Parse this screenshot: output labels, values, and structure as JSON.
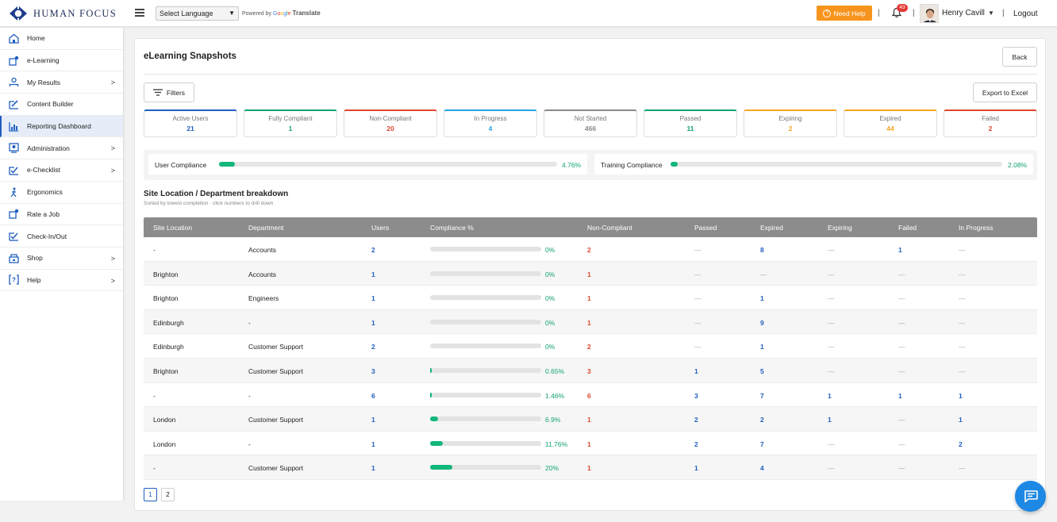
{
  "header": {
    "brand": "HUMAN FOCUS",
    "language_select": "Select Language",
    "powered_by": "Powered by",
    "google": [
      "G",
      "o",
      "o",
      "g",
      "l",
      "e"
    ],
    "translate": "Translate",
    "need_help": "Need Help",
    "notifications_count": "43",
    "user_name": "Henry Cavill",
    "logout": "Logout"
  },
  "sidebar": {
    "items": [
      {
        "label": "Home",
        "icon": "home-icon",
        "chevron": false
      },
      {
        "label": "e-Learning",
        "icon": "elearning-icon",
        "chevron": false
      },
      {
        "label": "My Results",
        "icon": "results-icon",
        "chevron": true
      },
      {
        "label": "Content Builder",
        "icon": "builder-icon",
        "chevron": false
      },
      {
        "label": "Reporting Dashboard",
        "icon": "chart-icon",
        "chevron": false,
        "active": true
      },
      {
        "label": "Administration",
        "icon": "admin-icon",
        "chevron": true
      },
      {
        "label": "e-Checklist",
        "icon": "checklist-icon",
        "chevron": true
      },
      {
        "label": "Ergonomics",
        "icon": "ergonomics-icon",
        "chevron": false
      },
      {
        "label": "Rate a Job",
        "icon": "rate-icon",
        "chevron": false
      },
      {
        "label": "Check-In/Out",
        "icon": "checkin-icon",
        "chevron": false
      },
      {
        "label": "Shop",
        "icon": "shop-icon",
        "chevron": true
      },
      {
        "label": "Help",
        "icon": "help-icon",
        "chevron": true
      }
    ]
  },
  "main": {
    "title": "eLearning Snapshots",
    "back": "Back",
    "filters": "Filters",
    "export": "Export to Excel",
    "tiles": [
      {
        "label": "Active Users",
        "value": "21",
        "color": "#1f5fbf"
      },
      {
        "label": "Fully Compliant",
        "value": "1",
        "color": "#12a36e"
      },
      {
        "label": "Non-Compliant",
        "value": "20",
        "color": "#e0452d"
      },
      {
        "label": "In Progress",
        "value": "4",
        "color": "#29a3e0"
      },
      {
        "label": "Not Started",
        "value": "466",
        "color": "#8a8a8a"
      },
      {
        "label": "Passed",
        "value": "11",
        "color": "#12a36e"
      },
      {
        "label": "Expiring",
        "value": "2",
        "color": "#f5a623"
      },
      {
        "label": "Expired",
        "value": "44",
        "color": "#f5a623"
      },
      {
        "label": "Failed",
        "value": "2",
        "color": "#e0452d"
      }
    ],
    "user_compliance": {
      "label": "User Compliance",
      "value": "4.76%",
      "fraction": 0.0476
    },
    "training_compliance": {
      "label": "Training Compliance",
      "value": "2.08%",
      "fraction": 0.0208
    },
    "breakdown_title": "Site Location / Department breakdown",
    "breakdown_subtitle": "Sorted by lowest completion · click numbers to drill down",
    "table": {
      "columns": [
        "Site Location",
        "Department",
        "Users",
        "Compliance %",
        "Non-Compliant",
        "Passed",
        "Expired",
        "Expiring",
        "Failed",
        "In Progress"
      ],
      "rows": [
        {
          "site": "-",
          "dept": "Accounts",
          "users": "2",
          "pct": "0%",
          "frac": 0.0,
          "non": "2",
          "passed": "—",
          "expired": "8",
          "expiring": "—",
          "failed": "1",
          "progress": "—"
        },
        {
          "site": "Brighton",
          "dept": "Accounts",
          "users": "1",
          "pct": "0%",
          "frac": 0.0,
          "non": "1",
          "passed": "—",
          "expired": "—",
          "expiring": "—",
          "failed": "—",
          "progress": "—"
        },
        {
          "site": "Brighton",
          "dept": "Engineers",
          "users": "1",
          "pct": "0%",
          "frac": 0.0,
          "non": "1",
          "passed": "—",
          "expired": "1",
          "expiring": "—",
          "failed": "—",
          "progress": "—"
        },
        {
          "site": "Edinburgh",
          "dept": "-",
          "users": "1",
          "pct": "0%",
          "frac": 0.0,
          "non": "1",
          "passed": "—",
          "expired": "9",
          "expiring": "—",
          "failed": "—",
          "progress": "—"
        },
        {
          "site": "Edinburgh",
          "dept": "Customer Support",
          "users": "2",
          "pct": "0%",
          "frac": 0.0,
          "non": "2",
          "passed": "—",
          "expired": "1",
          "expiring": "—",
          "failed": "—",
          "progress": "—"
        },
        {
          "site": "Brighton",
          "dept": "Customer Support",
          "users": "3",
          "pct": "0.65%",
          "frac": 0.0065,
          "non": "3",
          "passed": "1",
          "expired": "5",
          "expiring": "—",
          "failed": "—",
          "progress": "—"
        },
        {
          "site": "-",
          "dept": "-",
          "users": "6",
          "pct": "1.46%",
          "frac": 0.0146,
          "non": "6",
          "passed": "3",
          "expired": "7",
          "expiring": "1",
          "failed": "1",
          "progress": "1"
        },
        {
          "site": "London",
          "dept": "Customer Support",
          "users": "1",
          "pct": "6.9%",
          "frac": 0.069,
          "non": "1",
          "passed": "2",
          "expired": "2",
          "expiring": "1",
          "failed": "—",
          "progress": "1"
        },
        {
          "site": "London",
          "dept": "-",
          "users": "1",
          "pct": "11.76%",
          "frac": 0.1176,
          "non": "1",
          "passed": "2",
          "expired": "7",
          "expiring": "—",
          "failed": "—",
          "progress": "2"
        },
        {
          "site": "-",
          "dept": "Customer Support",
          "users": "1",
          "pct": "20%",
          "frac": 0.2,
          "non": "1",
          "passed": "1",
          "expired": "4",
          "expiring": "—",
          "failed": "—",
          "progress": "—"
        }
      ]
    },
    "pages": [
      "1",
      "2"
    ],
    "current_page": "1"
  }
}
